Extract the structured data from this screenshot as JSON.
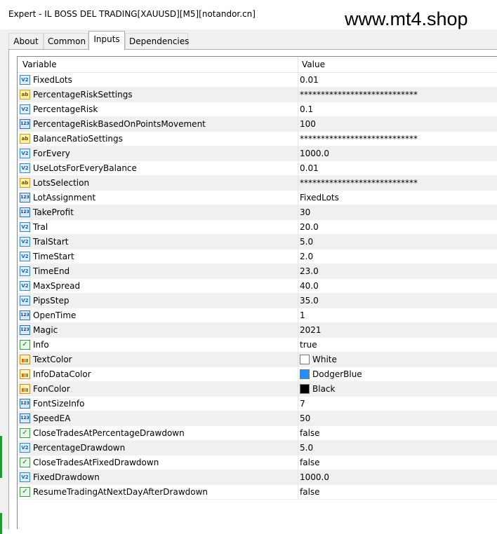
{
  "window": {
    "title": "Expert - IL BOSS DEL TRADING[XAUUSD][M5][notandor.cn]",
    "watermark": "www.mt4.shop"
  },
  "tabs": [
    {
      "label": "About",
      "active": false
    },
    {
      "label": "Common",
      "active": false
    },
    {
      "label": "Inputs",
      "active": true
    },
    {
      "label": "Dependencies",
      "active": false
    }
  ],
  "grid": {
    "columns": {
      "variable": "Variable",
      "value": "Value"
    },
    "rows": [
      {
        "icon": "v2",
        "name": "FixedLots",
        "value": "0.01"
      },
      {
        "icon": "ab",
        "name": "PercentageRiskSettings",
        "value": "****************************"
      },
      {
        "icon": "v2",
        "name": "PercentageRisk",
        "value": "0.1"
      },
      {
        "icon": "123",
        "name": "PercentageRiskBasedOnPointsMovement",
        "value": "100"
      },
      {
        "icon": "ab",
        "name": "BalanceRatioSettings",
        "value": "****************************"
      },
      {
        "icon": "v2",
        "name": "ForEvery",
        "value": "1000.0"
      },
      {
        "icon": "v2",
        "name": "UseLotsForEveryBalance",
        "value": "0.01"
      },
      {
        "icon": "ab",
        "name": "LotsSelection",
        "value": "****************************"
      },
      {
        "icon": "123",
        "name": "LotAssignment",
        "value": "FixedLots"
      },
      {
        "icon": "123",
        "name": "TakeProfit",
        "value": "30"
      },
      {
        "icon": "v2",
        "name": "Tral",
        "value": "20.0"
      },
      {
        "icon": "v2",
        "name": "TralStart",
        "value": "5.0"
      },
      {
        "icon": "v2",
        "name": "TimeStart",
        "value": "2.0"
      },
      {
        "icon": "v2",
        "name": "TimeEnd",
        "value": "23.0"
      },
      {
        "icon": "v2",
        "name": "MaxSpread",
        "value": "40.0"
      },
      {
        "icon": "v2",
        "name": "PipsStep",
        "value": "35.0"
      },
      {
        "icon": "123",
        "name": "OpenTime",
        "value": "1"
      },
      {
        "icon": "123",
        "name": "Magic",
        "value": "2021"
      },
      {
        "icon": "bool",
        "name": "Info",
        "value": "true"
      },
      {
        "icon": "color",
        "name": "TextColor",
        "value": "White",
        "swatch": "#ffffff"
      },
      {
        "icon": "color",
        "name": "InfoDataColor",
        "value": "DodgerBlue",
        "swatch": "#1e90ff"
      },
      {
        "icon": "color",
        "name": "FonColor",
        "value": "Black",
        "swatch": "#000000"
      },
      {
        "icon": "123",
        "name": "FontSizeInfo",
        "value": "7"
      },
      {
        "icon": "123",
        "name": "SpeedEA",
        "value": "50"
      },
      {
        "icon": "bool",
        "name": "CloseTradesAtPercentageDrawdown",
        "value": "false"
      },
      {
        "icon": "v2",
        "name": "PercentageDrawdown",
        "value": "5.0"
      },
      {
        "icon": "bool",
        "name": "CloseTradesAtFixedDrawdown",
        "value": "false"
      },
      {
        "icon": "v2",
        "name": "FixedDrawdown",
        "value": "1000.0"
      },
      {
        "icon": "bool",
        "name": "ResumeTradingAtNextDayAfterDrawdown",
        "value": "false"
      }
    ]
  }
}
